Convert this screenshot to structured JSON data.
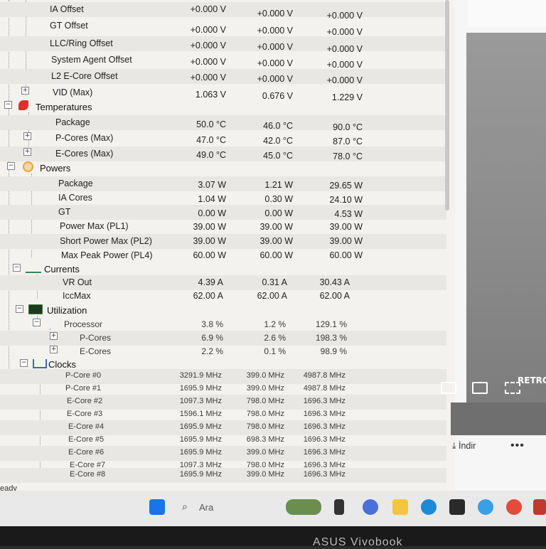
{
  "voltages": [
    {
      "label": "IA Offset",
      "v": [
        "+0.000 V",
        "+0.000 V",
        "+0.000 V"
      ]
    },
    {
      "label": "GT Offset",
      "v": [
        "+0.000 V",
        "+0.000 V",
        "+0.000 V"
      ]
    },
    {
      "label": "LLC/Ring Offset",
      "v": [
        "+0.000 V",
        "+0.000 V",
        "+0.000 V"
      ]
    },
    {
      "label": "System Agent Offset",
      "v": [
        "+0.000 V",
        "+0.000 V",
        "+0.000 V"
      ]
    },
    {
      "label": "L2 E-Core Offset",
      "v": [
        "+0.000 V",
        "+0.000 V",
        "+0.000 V"
      ]
    },
    {
      "label": "VID (Max)",
      "v": [
        "1.063 V",
        "0.676 V",
        "1.229 V"
      ]
    }
  ],
  "temperatures": {
    "title": "Temperatures",
    "rows": [
      {
        "label": "Package",
        "v": [
          "50.0 °C",
          "46.0 °C",
          "90.0 °C"
        ]
      },
      {
        "label": "P-Cores (Max)",
        "v": [
          "47.0 °C",
          "42.0 °C",
          "87.0 °C"
        ]
      },
      {
        "label": "E-Cores (Max)",
        "v": [
          "49.0 °C",
          "45.0 °C",
          "78.0 °C"
        ]
      }
    ]
  },
  "powers": {
    "title": "Powers",
    "rows": [
      {
        "label": "Package",
        "v": [
          "3.07 W",
          "1.21 W",
          "29.65 W"
        ]
      },
      {
        "label": "IA Cores",
        "v": [
          "1.04 W",
          "0.30 W",
          "24.10 W"
        ]
      },
      {
        "label": "GT",
        "v": [
          "0.00 W",
          "0.00 W",
          "4.53 W"
        ]
      },
      {
        "label": "Power Max (PL1)",
        "v": [
          "39.00 W",
          "39.00 W",
          "39.00 W"
        ]
      },
      {
        "label": "Short Power Max (PL2)",
        "v": [
          "39.00 W",
          "39.00 W",
          "39.00 W"
        ]
      },
      {
        "label": "Max Peak Power (PL4)",
        "v": [
          "60.00 W",
          "60.00 W",
          "60.00 W"
        ]
      }
    ]
  },
  "currents": {
    "title": "Currents",
    "rows": [
      {
        "label": "VR Out",
        "v": [
          "4.39 A",
          "0.31 A",
          "30.43 A"
        ]
      },
      {
        "label": "IccMax",
        "v": [
          "62.00 A",
          "62.00 A",
          "62.00 A"
        ]
      }
    ]
  },
  "utilization": {
    "title": "Utilization",
    "rows": [
      {
        "label": "Processor",
        "v": [
          "3.8 %",
          "1.2 %",
          "129.1 %"
        ]
      },
      {
        "label": "P-Cores",
        "v": [
          "6.9 %",
          "2.6 %",
          "198.3 %"
        ]
      },
      {
        "label": "E-Cores",
        "v": [
          "2.2 %",
          "0.1 %",
          "98.9 %"
        ]
      }
    ]
  },
  "clocks": {
    "title": "Clocks",
    "rows": [
      {
        "label": "P-Core #0",
        "v": [
          "3291.9 MHz",
          "399.0 MHz",
          "4987.8 MHz"
        ]
      },
      {
        "label": "P-Core #1",
        "v": [
          "1695.9 MHz",
          "399.0 MHz",
          "4987.8 MHz"
        ]
      },
      {
        "label": "E-Core #2",
        "v": [
          "1097.3 MHz",
          "798.0 MHz",
          "1696.3 MHz"
        ]
      },
      {
        "label": "E-Core #3",
        "v": [
          "1596.1 MHz",
          "798.0 MHz",
          "1696.3 MHz"
        ]
      },
      {
        "label": "E-Core #4",
        "v": [
          "1695.9 MHz",
          "798.0 MHz",
          "1696.3 MHz"
        ]
      },
      {
        "label": "E-Core #5",
        "v": [
          "1695.9 MHz",
          "698.3 MHz",
          "1696.3 MHz"
        ]
      },
      {
        "label": "E-Core #6",
        "v": [
          "1695.9 MHz",
          "399.0 MHz",
          "1696.3 MHz"
        ]
      },
      {
        "label": "E-Core #7",
        "v": [
          "1097.3 MHz",
          "798.0 MHz",
          "1696.3 MHz"
        ]
      },
      {
        "label": "E-Core #8",
        "v": [
          "1695.9 MHz",
          "399.0 MHz",
          "1696.3 MHz"
        ]
      }
    ]
  },
  "status_text": "eady",
  "video": {
    "watermark": "RETRO",
    "download_label": "İndir",
    "more_label": "•••"
  },
  "taskbar": {
    "search_placeholder": "Ara"
  },
  "laptop_brand": "ASUS Vivobook",
  "colors": {
    "temp_icon": "#d9342b",
    "power_icon": "#e8a33b",
    "util_icon": "#2e7d32",
    "win_blue": "#1a73e8"
  }
}
